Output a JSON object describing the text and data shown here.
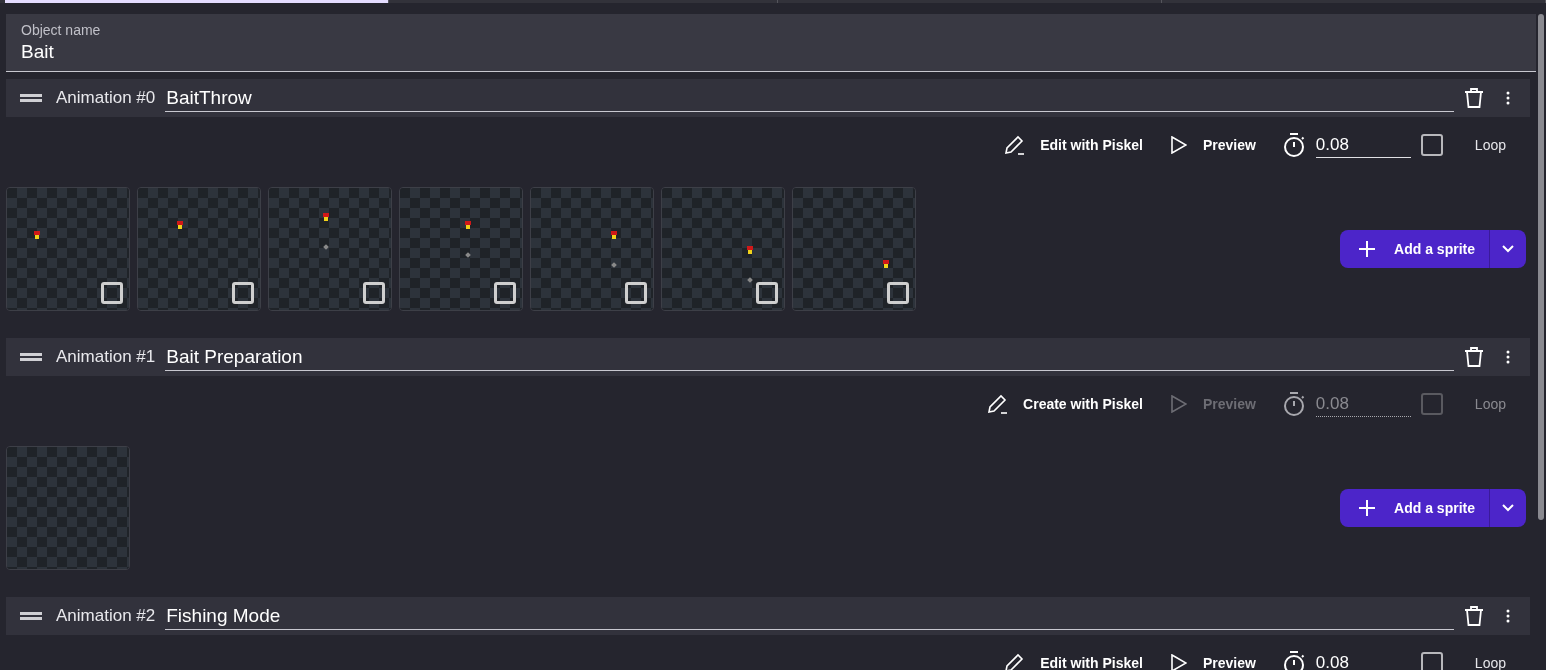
{
  "tabs": [
    {
      "selected": true
    },
    {
      "selected": false
    },
    {
      "selected": false
    },
    {
      "selected": false
    }
  ],
  "object_name": {
    "label": "Object name",
    "value": "Bait"
  },
  "animations": [
    {
      "label": "Animation #0",
      "name": "BaitThrow",
      "edit_button": "Edit with Piskel",
      "preview": "Preview",
      "duration": "0.08",
      "loop_label": "Loop",
      "loop": false,
      "disabled": false,
      "add_button": "Add a sprite",
      "frames": [
        {
          "checked": false
        },
        {
          "checked": false
        },
        {
          "checked": false
        },
        {
          "checked": false
        },
        {
          "checked": false
        },
        {
          "checked": false
        },
        {
          "checked": false
        }
      ]
    },
    {
      "label": "Animation #1",
      "name": "Bait Preparation",
      "edit_button": "Create with Piskel",
      "preview": "Preview",
      "duration": "0.08",
      "loop_label": "Loop",
      "loop": false,
      "disabled": true,
      "add_button": "Add a sprite",
      "frames": [
        {
          "kind": "empty"
        }
      ]
    },
    {
      "label": "Animation #2",
      "name": "Fishing Mode",
      "edit_button": "Edit with Piskel",
      "preview": "Preview",
      "duration": "0.08",
      "loop_label": "Loop",
      "loop": false,
      "disabled": false
    }
  ]
}
